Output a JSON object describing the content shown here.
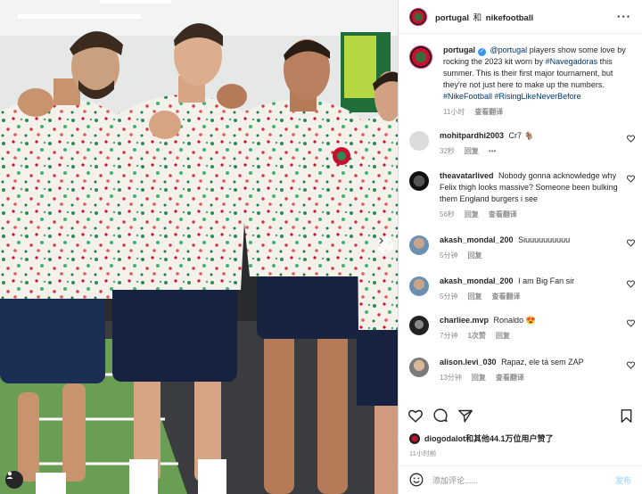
{
  "post": {
    "author": "portugal",
    "collaborator": "nikefootball",
    "and_text": "和",
    "more_icon": "more-dots-icon",
    "caption": {
      "username": "portugal",
      "mention": "@portugal",
      "text": "players show some love by rocking the 2023 kit worn by",
      "hashtag_1": "#Navegadoras",
      "text_2": "this summer. This is their first major tournament, but they're not just here to make up the numbers.",
      "hashtag_2": "#NikeFootball",
      "hashtag_3": "#RisingLikeNeverBefore",
      "time": "11小时",
      "translate": "查看翻译"
    }
  },
  "comments": [
    {
      "username": "mohitpardhi2003",
      "text": "Cr7 🐐",
      "time": "32秒",
      "reply": "回复",
      "more": "•••"
    },
    {
      "username": "theavatarlived",
      "text": "Nobody gonna acknowledge why Felix thigh looks massive? Someone been bulking them England burgers i see",
      "time": "56秒",
      "reply": "回复",
      "translate": "查看翻译"
    },
    {
      "username": "akash_mondal_200",
      "text": "Siuuuuuuuuuu",
      "time": "5分钟",
      "reply": "回复"
    },
    {
      "username": "akash_mondal_200",
      "text": "I am Big Fan sir",
      "time": "5分钟",
      "reply": "回复",
      "translate": "查看翻译"
    },
    {
      "username": "charliee.mvp",
      "text": "Ronaldo 😍",
      "time": "7分钟",
      "likes": "1次赞",
      "reply": "回复"
    },
    {
      "username": "alison.levi_030",
      "text": "Rapaz, ele tá sem ZAP",
      "time": "13分钟",
      "reply": "回复",
      "translate": "查看翻译"
    }
  ],
  "actions": {
    "like_icon": "heart-icon",
    "comment_icon": "comment-bubble-icon",
    "share_icon": "paper-plane-icon",
    "save_icon": "bookmark-icon"
  },
  "likes": {
    "first_user": "diogodalot",
    "rest": "和其他44.1万位用户赞了"
  },
  "post_time": "11小时前",
  "comment_box": {
    "placeholder": "添加评论......",
    "post_label": "发布",
    "emoji_icon": "smiley-icon"
  },
  "photo": {
    "next_icon": "chevron-right-icon",
    "tag_icon": "user-tag-icon"
  },
  "colors": {
    "link": "#00376b",
    "meta_gray": "#8e8e8e",
    "post_disabled": "#b2dffc",
    "verified": "#3897f0"
  }
}
